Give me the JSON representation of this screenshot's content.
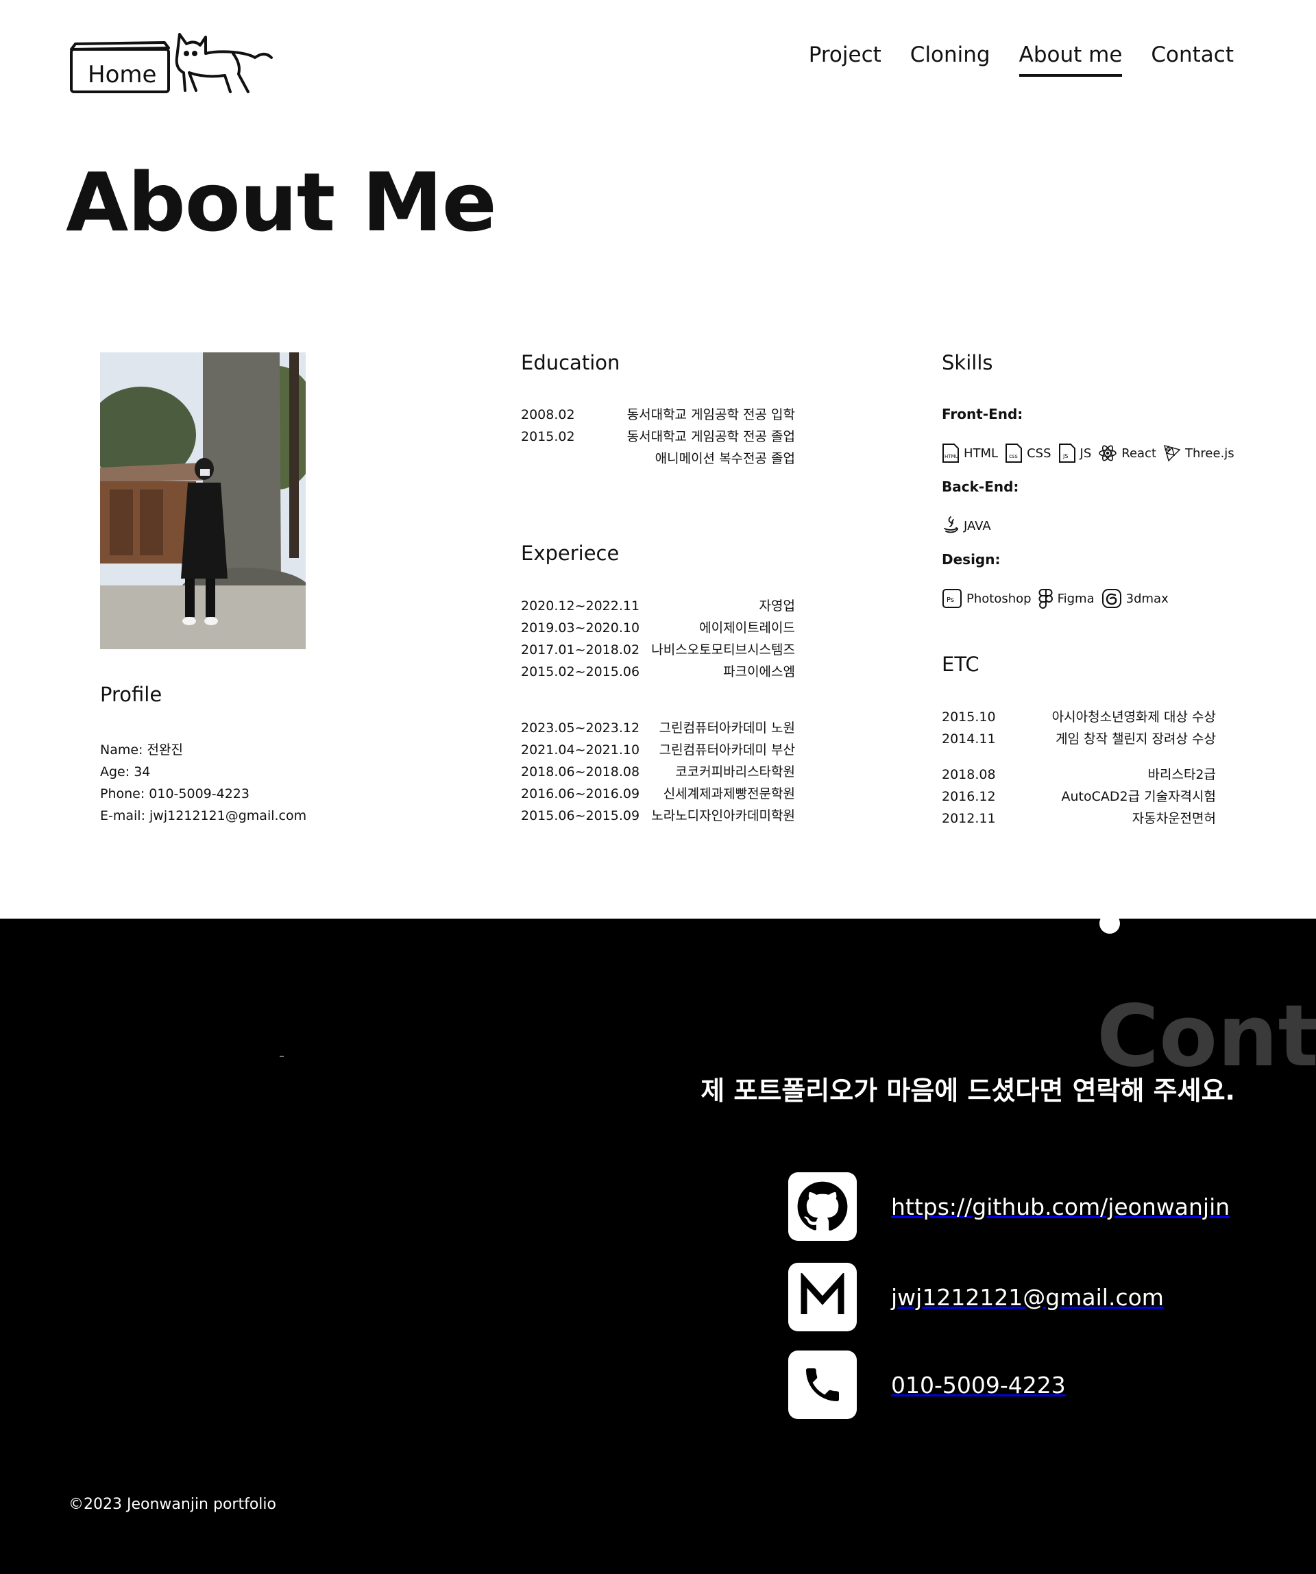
{
  "header": {
    "logo_text": "Home",
    "nav": [
      "Project",
      "Cloning",
      "About me",
      "Contact"
    ],
    "active_nav": "About me"
  },
  "page_title": "About Me",
  "profile": {
    "title": "Profile",
    "items": [
      "Name: 전완진",
      "Age: 34",
      "Phone: 010-5009-4223",
      "E-mail: jwj1212121@gmail.com"
    ]
  },
  "education": {
    "title": "Education",
    "rows": [
      {
        "date": "2008.02",
        "text": "동서대학교 게임공학 전공 입학"
      },
      {
        "date": "2015.02",
        "text": "동서대학교 게임공학 전공 졸업"
      },
      {
        "date": "",
        "text": "애니메이션 복수전공 졸업"
      }
    ]
  },
  "experience": {
    "title": "Experiece",
    "rows": [
      {
        "date": "2020.12~2022.11",
        "text": "자영업"
      },
      {
        "date": "2019.03~2020.10",
        "text": "에이제이트레이드"
      },
      {
        "date": "2017.01~2018.02",
        "text": "나비스오토모티브시스템즈"
      },
      {
        "date": "2015.02~2015.06",
        "text": "파크이에스엠"
      }
    ],
    "rows2": [
      {
        "date": "2023.05~2023.12",
        "text": "그린컴퓨터아카데미 노원"
      },
      {
        "date": "2021.04~2021.10",
        "text": "그린컴퓨터아카데미 부산"
      },
      {
        "date": "2018.06~2018.08",
        "text": "코코커피바리스타학원"
      },
      {
        "date": "2016.06~2016.09",
        "text": "신세계제과제빵전문학원"
      },
      {
        "date": "2015.06~2015.09",
        "text": "노라노디자인아카데미학원"
      }
    ]
  },
  "skills": {
    "title": "Skills",
    "groups": [
      {
        "label": "Front-End:",
        "items": [
          "HTML",
          "CSS",
          "JS",
          "React",
          "Three.js"
        ]
      },
      {
        "label": "Back-End:",
        "items": [
          "JAVA"
        ]
      },
      {
        "label": "Design:",
        "items": [
          "Photoshop",
          "Figma",
          "3dmax"
        ]
      }
    ]
  },
  "etc": {
    "title": "ETC",
    "rows": [
      {
        "date": "2015.10",
        "text": "아시아청소년영화제 대상 수상"
      },
      {
        "date": "2014.11",
        "text": "게임 창작 챌린지 장려상 수상"
      }
    ],
    "rows2": [
      {
        "date": "2018.08",
        "text": "바리스타2급"
      },
      {
        "date": "2016.12",
        "text": "AutoCAD2급 기술자격시험"
      },
      {
        "date": "2012.11",
        "text": "자동차운전면허"
      }
    ]
  },
  "contact": {
    "big_title": "Conta",
    "message": "제 포트폴리오가 마음에 드셨다면 연락해 주세요.",
    "github": "https://github.com/jeonwanjin",
    "email": "jwj1212121@gmail.com",
    "phone": "010-5009-4223"
  },
  "footer": {
    "copyright": "©2023 Jeonwanjin portfolio"
  },
  "colors": {
    "dark_bg": "#000000",
    "text": "#111111",
    "contact_faded": "#3a3a3a"
  },
  "icons": [
    "cat-icon",
    "html-file-icon",
    "css-file-icon",
    "js-file-icon",
    "react-icon",
    "threejs-icon",
    "java-icon",
    "photoshop-icon",
    "figma-icon",
    "3dmax-icon",
    "github-icon",
    "mail-icon",
    "phone-icon"
  ]
}
